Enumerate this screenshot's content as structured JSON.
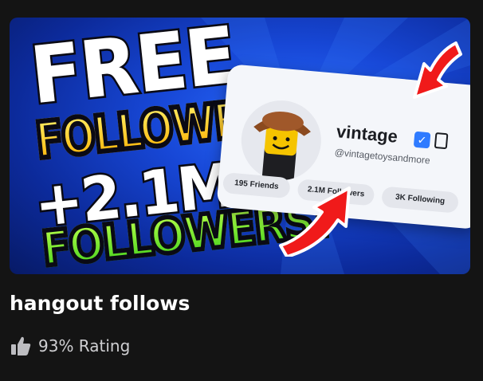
{
  "experience": {
    "title": "hangout follows",
    "rating_text": "93% Rating",
    "rating_icon": "thumbs-up-icon"
  },
  "thumbnail": {
    "headline_line1": "FREE",
    "headline_line2": "FOLLOWERS!",
    "headline_line3": "+2.1M",
    "headline_line4": "FOLLOWERS!",
    "profile": {
      "username": "vintage",
      "handle": "@vintagetoysandmore",
      "friends": "195 Friends",
      "followers": "2.1M Followers",
      "following": "3K Following"
    }
  },
  "colors": {
    "background": "#141414",
    "thumbnail_blue": "#1747d6",
    "arrow_red": "#f01a1a",
    "verified_blue": "#2f7bff"
  }
}
